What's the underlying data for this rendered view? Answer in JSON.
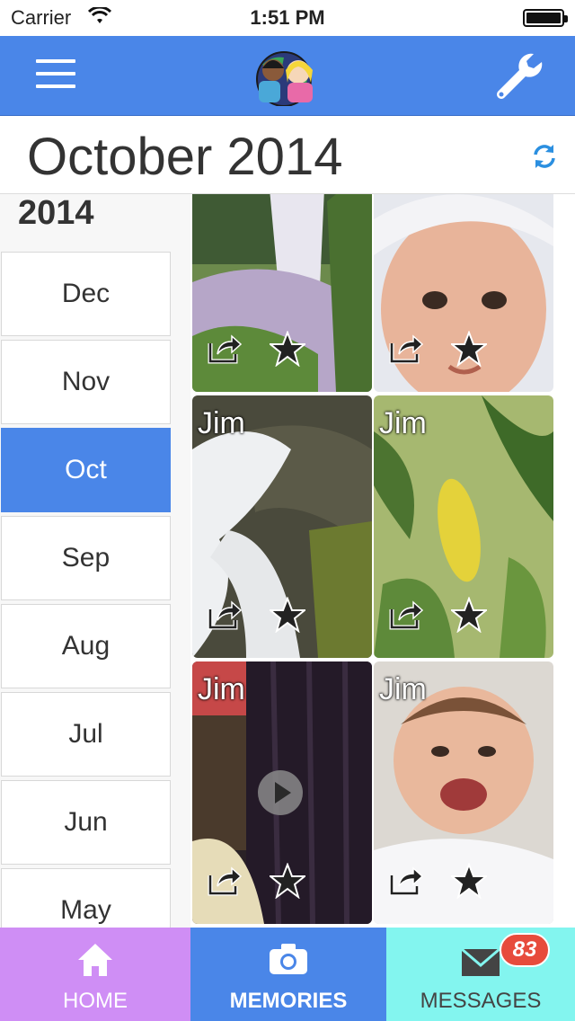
{
  "status_bar": {
    "carrier": "Carrier",
    "time": "1:51 PM"
  },
  "nav": {
    "menu_icon": "hamburger-icon",
    "settings_icon": "wrench-icon",
    "logo": "kids-logo"
  },
  "header": {
    "title": "October 2014",
    "refresh_icon": "refresh-icon"
  },
  "sidebar": {
    "year": "2014",
    "months": [
      {
        "label": "Dec",
        "active": false
      },
      {
        "label": "Nov",
        "active": false
      },
      {
        "label": "Oct",
        "active": true
      },
      {
        "label": "Sep",
        "active": false
      },
      {
        "label": "Aug",
        "active": false
      },
      {
        "label": "Jul",
        "active": false
      },
      {
        "label": "Jun",
        "active": false
      },
      {
        "label": "May",
        "active": false
      }
    ]
  },
  "photos": [
    {
      "author": "",
      "kind": "waterfall",
      "video": false
    },
    {
      "author": "",
      "kind": "baby",
      "video": false
    },
    {
      "author": "Jim",
      "kind": "waterfall-rocks",
      "video": false
    },
    {
      "author": "Jim",
      "kind": "leaves",
      "video": false
    },
    {
      "author": "Jim",
      "kind": "room",
      "video": true
    },
    {
      "author": "Jim",
      "kind": "baby-laughing",
      "video": false
    }
  ],
  "tabs": {
    "home": {
      "label": "HOME",
      "icon": "home-icon"
    },
    "memories": {
      "label": "MEMORIES",
      "icon": "camera-icon"
    },
    "messages": {
      "label": "MESSAGES",
      "icon": "envelope-icon",
      "badge": "83"
    }
  },
  "colors": {
    "accent": "#4a86e8",
    "home_tab": "#cf8ef5",
    "messages_tab": "#83f5ef",
    "badge": "#e74b3c"
  }
}
